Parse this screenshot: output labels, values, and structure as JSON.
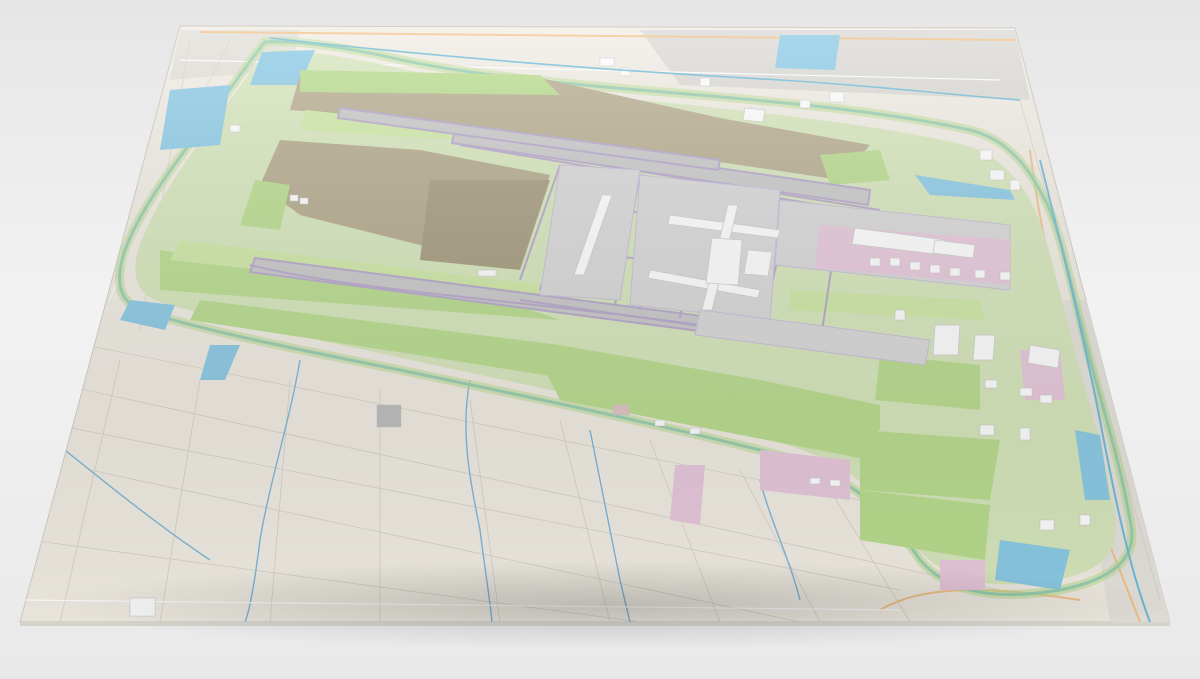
{
  "scene": {
    "description_name": "3d-terrain-map-model",
    "colors": {
      "background": "#ececec",
      "land": "#f1ede4",
      "field_lines": "#d8d2c6",
      "road_minor": "#ffffff",
      "road_major": "#f3c38a",
      "water": "#8ccbe6",
      "water_canal": "#6fbcd9",
      "grass": "#b9dd8e",
      "grass_light": "#cfe9a6",
      "airfield_dirt": "#b8ad90",
      "airfield_dirt_dark": "#a59b7e",
      "apron": "#d9d9d9",
      "taxiway": "#b7a8cc",
      "runway": "#c9c9c9",
      "terminal": "#ffffff",
      "commercial": "#e8c9dc",
      "residential": "#dcdad6"
    },
    "icons": [
      "terminal-building",
      "runway",
      "canal",
      "field-parcel"
    ]
  }
}
